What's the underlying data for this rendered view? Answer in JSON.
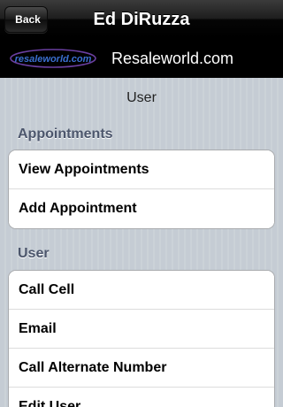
{
  "navbar": {
    "back_label": "Back",
    "title": "Ed DiRuzza"
  },
  "banner": {
    "logo_text": "resaleworld.com",
    "title": "Resaleworld.com"
  },
  "page_label": "User",
  "sections": [
    {
      "header": "Appointments",
      "items": [
        "View Appointments",
        "Add Appointment"
      ]
    },
    {
      "header": "User",
      "items": [
        "Call Cell",
        "Email",
        "Call Alternate Number",
        "Edit User"
      ]
    }
  ]
}
